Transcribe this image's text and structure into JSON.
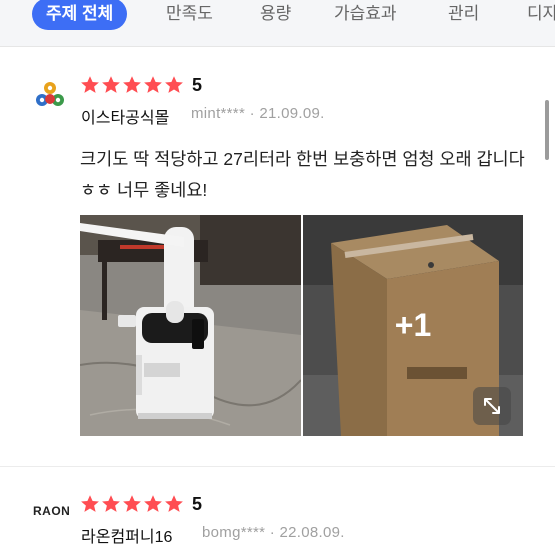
{
  "tabs": [
    {
      "label": "주제 전체",
      "active": true
    },
    {
      "label": "만족도",
      "active": false
    },
    {
      "label": "용량",
      "active": false
    },
    {
      "label": "가습효과",
      "active": false
    },
    {
      "label": "관리",
      "active": false
    },
    {
      "label": "디자",
      "active": false
    }
  ],
  "colors": {
    "accent": "#3d6ef5",
    "star": "#ff4d52"
  },
  "reviews": [
    {
      "rating": "5",
      "stars": 5,
      "store": "이스타공식몰",
      "user": "mint****",
      "date": "21.09.09.",
      "text": "크기도 딱 적당하고 27리터라 한번 보충하면 엄청 오래 갑니다 ㅎㅎ 너무 좋네요!",
      "more_photos": "+1"
    },
    {
      "rating": "5",
      "stars": 5,
      "logo_text": "RAON",
      "store": "라온컴퍼니16",
      "user": "bomg****",
      "date": "22.08.09."
    }
  ]
}
